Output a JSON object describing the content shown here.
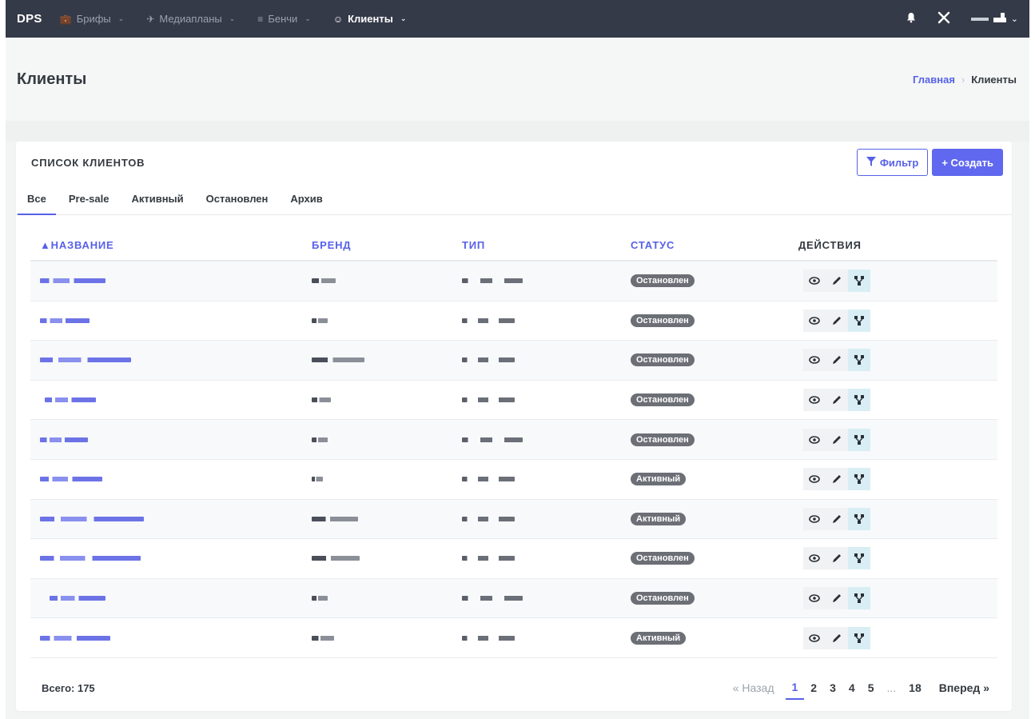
{
  "topbar": {
    "logo": "DPS",
    "nav": [
      {
        "label": "Брифы",
        "icon": "briefcase-icon",
        "active": false
      },
      {
        "label": "Медиапланы",
        "icon": "plane-icon",
        "active": false
      },
      {
        "label": "Бенчи",
        "icon": "chart-icon",
        "active": false
      },
      {
        "label": "Клиенты",
        "icon": "users-icon",
        "active": true
      }
    ]
  },
  "header": {
    "title": "Клиенты",
    "breadcrumb": {
      "home": "Главная",
      "current": "Клиенты"
    }
  },
  "card": {
    "title": "СПИСОК КЛИЕНТОВ",
    "filter_label": "Фильтр",
    "create_label": "+ Создать",
    "tabs": [
      "Все",
      "Pre-sale",
      "Активный",
      "Остановлен",
      "Архив"
    ],
    "active_tab": "Все"
  },
  "table": {
    "columns": [
      "▲НАЗВАНИЕ",
      "БРЕНД",
      "ТИП",
      "СТАТУС",
      "ДЕЙСТВИЯ"
    ],
    "rows": [
      {
        "status": "Остановлен"
      },
      {
        "status": "Остановлен"
      },
      {
        "status": "Остановлен"
      },
      {
        "status": "Остановлен"
      },
      {
        "status": "Остановлен"
      },
      {
        "status": "Активный"
      },
      {
        "status": "Активный"
      },
      {
        "status": "Остановлен"
      },
      {
        "status": "Остановлен"
      },
      {
        "status": "Активный"
      }
    ]
  },
  "footer": {
    "total": "Всего: 175",
    "prev": "« Назад",
    "pages": [
      "1",
      "2",
      "3",
      "4",
      "5",
      "...",
      "18"
    ],
    "current_page": "1",
    "next": "Вперед »"
  },
  "colors": {
    "accent": "#5761e8",
    "topbar": "#353a48",
    "badge": "#6c6f76"
  }
}
